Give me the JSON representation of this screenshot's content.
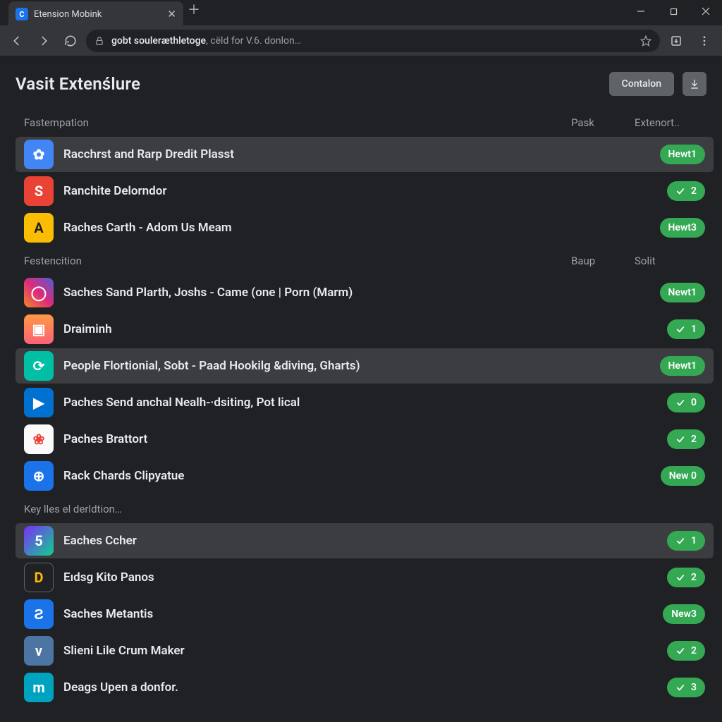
{
  "window": {
    "tab_title": "Etension Mobink"
  },
  "omnibox": {
    "host": "gobt souleræthletoge",
    "rest": ", cëld for V.6. donlon…"
  },
  "header": {
    "title": "Vasit Extenślure",
    "primary_button": "Contalon"
  },
  "sections": [
    {
      "head": {
        "a": "Fastempation",
        "b": "Pask",
        "c": "Extenort.."
      },
      "rows": [
        {
          "hi": true,
          "icon": {
            "cls": "bg-blue",
            "glyph": "✿"
          },
          "title": "Racchrst and Rarp Dredit Plasst",
          "pill": {
            "type": "label",
            "text": "Hewt1"
          }
        },
        {
          "hi": false,
          "icon": {
            "cls": "bg-red",
            "glyph": "S"
          },
          "title": "Ranchite Delorndor",
          "pill": {
            "type": "count",
            "text": "2"
          }
        },
        {
          "hi": false,
          "icon": {
            "cls": "bg-yellow",
            "glyph": "A"
          },
          "title": "Raches Carth - Adom Us Meam",
          "pill": {
            "type": "label",
            "text": "Hewt3"
          }
        }
      ]
    },
    {
      "head": {
        "a": "Festencition",
        "b": "Baup",
        "c": "Solit"
      },
      "rows": [
        {
          "hi": false,
          "icon": {
            "cls": "bg-ig",
            "glyph": "◯"
          },
          "title": "Saches Sand Plarth, Joshs - Came (one | Porn (Marm)",
          "pill": {
            "type": "label",
            "text": "Newt1"
          }
        },
        {
          "hi": false,
          "icon": {
            "cls": "bg-orange",
            "glyph": "▣"
          },
          "title": "Draiminh",
          "pill": {
            "type": "count",
            "text": "1"
          }
        },
        {
          "hi": true,
          "icon": {
            "cls": "bg-teal",
            "glyph": "⟳"
          },
          "title": "People Flortionial, Sobt - Paad Hookilg &diving, Gharts)",
          "pill": {
            "type": "label",
            "text": "Hewt1"
          }
        },
        {
          "hi": false,
          "icon": {
            "cls": "bg-pb",
            "glyph": "▶"
          },
          "title": "Paches Send anchal Nealh-·dsiting, Pot lical",
          "pill": {
            "type": "count",
            "text": "0"
          }
        },
        {
          "hi": false,
          "icon": {
            "cls": "bg-flower",
            "glyph": "❀"
          },
          "title": "Paches Brattort",
          "pill": {
            "type": "count",
            "text": "2"
          }
        },
        {
          "hi": false,
          "icon": {
            "cls": "bg-globe",
            "glyph": "⊕"
          },
          "title": "Rack Chards Clipyatue",
          "pill": {
            "type": "label",
            "text": "New 0"
          }
        }
      ]
    },
    {
      "head": {
        "a": "Key lles el derldtion…",
        "b": "",
        "c": ""
      },
      "rows": [
        {
          "hi": true,
          "icon": {
            "cls": "bg-purple",
            "glyph": "5"
          },
          "title": "Eaches Ccher",
          "pill": {
            "type": "count",
            "text": "1"
          }
        },
        {
          "hi": false,
          "icon": {
            "cls": "bg-dark",
            "glyph": "D"
          },
          "title": "Eıdsg Kito Panos",
          "pill": {
            "type": "count",
            "text": "2"
          }
        },
        {
          "hi": false,
          "icon": {
            "cls": "bg-swirl",
            "glyph": "Ƨ"
          },
          "title": "Saches Metantis",
          "pill": {
            "type": "label",
            "text": "New3"
          }
        },
        {
          "hi": false,
          "icon": {
            "cls": "bg-vk",
            "glyph": "v"
          },
          "title": "Slieni Lile Crum Maker",
          "pill": {
            "type": "count",
            "text": "2"
          }
        },
        {
          "hi": false,
          "icon": {
            "cls": "bg-mny",
            "glyph": "m"
          },
          "title": "Deags Upen a donfor.",
          "pill": {
            "type": "count",
            "text": "3"
          }
        }
      ]
    }
  ]
}
